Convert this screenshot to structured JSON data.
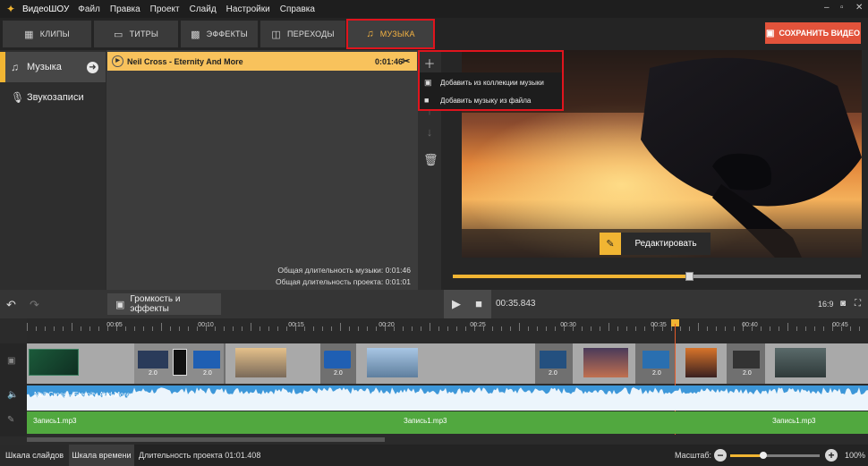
{
  "menubar": {
    "app_name": "ВидеоШОУ",
    "items": [
      "Файл",
      "Правка",
      "Проект",
      "Слайд",
      "Настройки",
      "Справка"
    ],
    "window_controls": [
      "‒",
      "▫",
      "✕"
    ]
  },
  "tabs": [
    {
      "label": "Клипы",
      "icon": "film-icon"
    },
    {
      "label": "Титры",
      "icon": "titles-icon"
    },
    {
      "label": "Эффекты",
      "icon": "effects-icon"
    },
    {
      "label": "Переходы",
      "icon": "transitions-icon"
    },
    {
      "label": "Музыка",
      "icon": "music-note-icon",
      "active": true
    }
  ],
  "save_button": "Сохранить видео",
  "sidebar": {
    "items": [
      {
        "label": "Музыка",
        "icon": "music-note-icon",
        "active": true
      },
      {
        "label": "Звукозаписи",
        "icon": "microphone-icon"
      }
    ]
  },
  "music_list": {
    "track": {
      "name": "Neil Cross - Eternity And More",
      "duration": "0:01:46"
    },
    "total_music_label": "Общая длительность музыки: 0:01:46",
    "total_project_label": "Общая длительность проекта: 0:01:01"
  },
  "dropdown": {
    "items": [
      {
        "label": "Добавить из коллекции музыки",
        "icon": "music-collection-icon"
      },
      {
        "label": "Добавить музыку из файла",
        "icon": "folder-icon"
      }
    ]
  },
  "preview": {
    "edit_button": "Редактировать",
    "progress": 0.58
  },
  "toolbar": {
    "volume_button": "Громкость и эффекты",
    "timecode": "00:35.843",
    "aspect_ratio": "16:9"
  },
  "timeline": {
    "ruler_ticks": [
      "00:05",
      "00:10",
      "00:15",
      "00:20",
      "00:25",
      "00:30",
      "00:35",
      "00:40",
      "00:45"
    ],
    "slide_durations": [
      "2.0",
      "2.0",
      "2.0",
      "2.0",
      "2.0",
      "2.0",
      "2.0",
      "2.0"
    ],
    "audio_track_label": "Neil Cross - Eternity And More",
    "record_labels": [
      "Запись1.mp3",
      "Запись1.mp3",
      "Запись1.mp3"
    ]
  },
  "statusbar": {
    "tab_slides": "Шкала слайдов",
    "tab_timeline": "Шкала времени",
    "project_duration": "Длительность проекта 01:01.408",
    "zoom_label": "Масштаб:",
    "zoom_value": "100%"
  },
  "colors": {
    "accent": "#f1b533",
    "save_button": "#e2533b",
    "highlight_box": "#e0141d",
    "audio_track": "#3d97d9",
    "record_track": "#51a83f"
  }
}
